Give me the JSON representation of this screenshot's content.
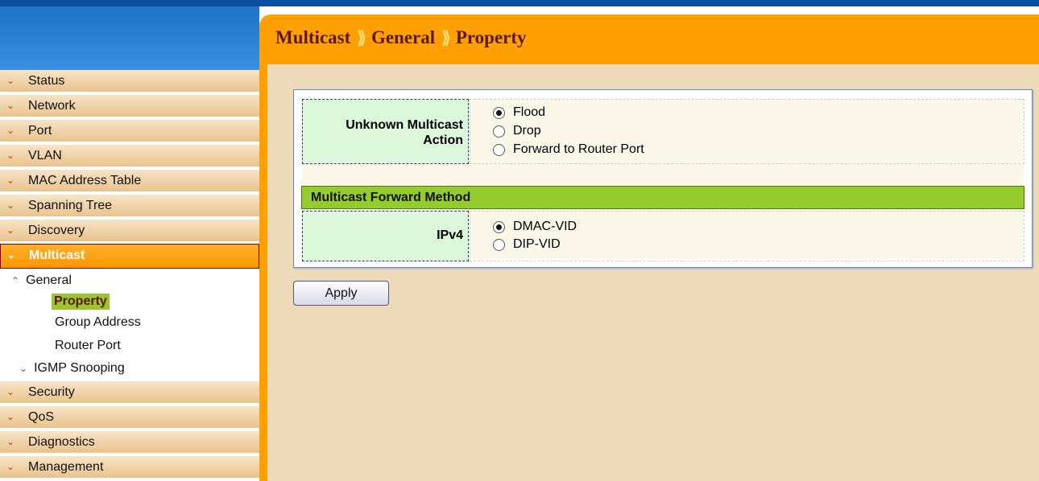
{
  "breadcrumb": {
    "level1": "Multicast",
    "level2": "General",
    "level3": "Property",
    "separator": "⟫"
  },
  "sidebar": {
    "items_top": [
      {
        "label": "Status"
      },
      {
        "label": "Network"
      },
      {
        "label": "Port"
      },
      {
        "label": "VLAN"
      },
      {
        "label": "MAC Address Table"
      },
      {
        "label": "Spanning Tree"
      },
      {
        "label": "Discovery"
      }
    ],
    "active": {
      "label": "Multicast"
    },
    "submenu": {
      "general": "General",
      "property": "Property",
      "group_address": "Group Address",
      "router_port": "Router Port",
      "igmp_snooping": "IGMP Snooping"
    },
    "items_bottom": [
      {
        "label": "Security"
      },
      {
        "label": "QoS"
      },
      {
        "label": "Diagnostics"
      },
      {
        "label": "Management"
      }
    ]
  },
  "form": {
    "unknown_multicast": {
      "label_line1": "Unknown Multicast",
      "label_line2": "Action",
      "options": [
        "Flood",
        "Drop",
        "Forward to Router Port"
      ],
      "selected": "Flood"
    },
    "section_title": "Multicast Forward Method",
    "ipv4": {
      "label": "IPv4",
      "options": [
        "DMAC-VID",
        "DIP-VID"
      ],
      "selected": "DMAC-VID"
    },
    "apply_label": "Apply"
  },
  "colors": {
    "header_orange": "#ffa000",
    "content_bg": "#ecdab9",
    "section_green": "#94cc2e",
    "label_green": "#dcf7da"
  }
}
